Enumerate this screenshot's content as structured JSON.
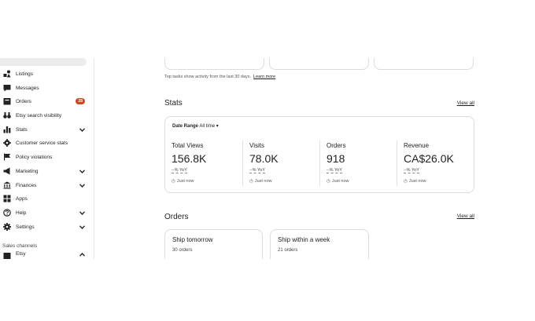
{
  "sidebar": {
    "items": [
      {
        "label": "Listings",
        "icon": "shapes-icon"
      },
      {
        "label": "Messages",
        "icon": "message-icon"
      },
      {
        "label": "Orders",
        "icon": "box-icon",
        "badge": "28"
      },
      {
        "label": "Etsy search visibility",
        "icon": "binoculars-icon"
      },
      {
        "label": "Stats",
        "icon": "bar-chart-icon",
        "chevron": true
      },
      {
        "label": "Customer service stats",
        "icon": "gear-icon"
      },
      {
        "label": "Policy violations",
        "icon": "flag-icon"
      },
      {
        "label": "Marketing",
        "icon": "megaphone-icon",
        "chevron": true
      },
      {
        "label": "Finances",
        "icon": "bank-icon",
        "chevron": true
      },
      {
        "label": "Apps",
        "icon": "apps-grid-icon"
      },
      {
        "label": "Help",
        "icon": "help-icon",
        "chevron": true
      },
      {
        "label": "Settings",
        "icon": "settings-icon",
        "chevron": true
      }
    ],
    "sales_channels_label": "Sales channels",
    "channel": {
      "label": "Etsy"
    }
  },
  "main": {
    "top_note": "Top tasks show activity from the last 30 days.",
    "learn_more": "Learn more",
    "stats": {
      "title": "Stats",
      "view_all": "View all",
      "date_range_label": "Date Range",
      "date_range_value": "All time",
      "metrics": [
        {
          "label": "Total Views",
          "value": "156.8K",
          "yoy": "--% YoY",
          "time": "Just now"
        },
        {
          "label": "Visits",
          "value": "78.0K",
          "yoy": "--% YoY",
          "time": "Just now"
        },
        {
          "label": "Orders",
          "value": "918",
          "yoy": "--% YoY",
          "time": "Just now"
        },
        {
          "label": "Revenue",
          "value": "CA$26.0K",
          "yoy": "--% YoY",
          "time": "Just now"
        }
      ]
    },
    "orders": {
      "title": "Orders",
      "view_all": "View all",
      "cards": [
        {
          "title": "Ship tomorrow",
          "count": "30 orders"
        },
        {
          "title": "Ship within a week",
          "count": "21 orders"
        }
      ]
    }
  },
  "colors": {
    "badge": "#d0461e",
    "border": "#dcdcdc",
    "text": "#222222"
  }
}
